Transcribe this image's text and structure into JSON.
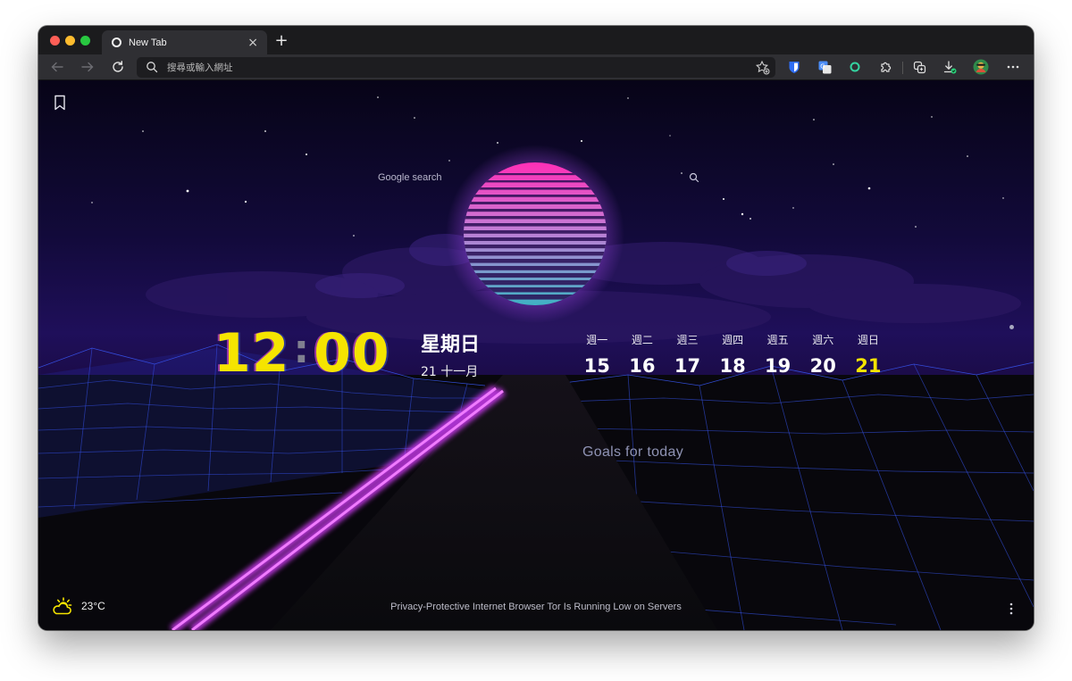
{
  "tab": {
    "title": "New Tab"
  },
  "addressbar": {
    "placeholder": "搜尋或輸入網址"
  },
  "search": {
    "placeholder": "Google search"
  },
  "clock": {
    "hours": "12",
    "minutes": "00",
    "colon": ":"
  },
  "date": {
    "weekday": "星期日",
    "line": "21 十一月"
  },
  "week": [
    {
      "label": "週一",
      "num": "15"
    },
    {
      "label": "週二",
      "num": "16"
    },
    {
      "label": "週三",
      "num": "17"
    },
    {
      "label": "週四",
      "num": "18"
    },
    {
      "label": "週五",
      "num": "19"
    },
    {
      "label": "週六",
      "num": "20"
    },
    {
      "label": "週日",
      "num": "21",
      "today": true
    }
  ],
  "goals": "Goals for today",
  "weather": {
    "temp": "23°C",
    "icon": "partly-cloudy-icon"
  },
  "news": "Privacy-Protective Internet Browser Tor Is Running Low on Servers",
  "colors": {
    "accent": "#f5e400",
    "sun_top": "#ff2fb6",
    "sun_bottom": "#3fb2c4"
  }
}
